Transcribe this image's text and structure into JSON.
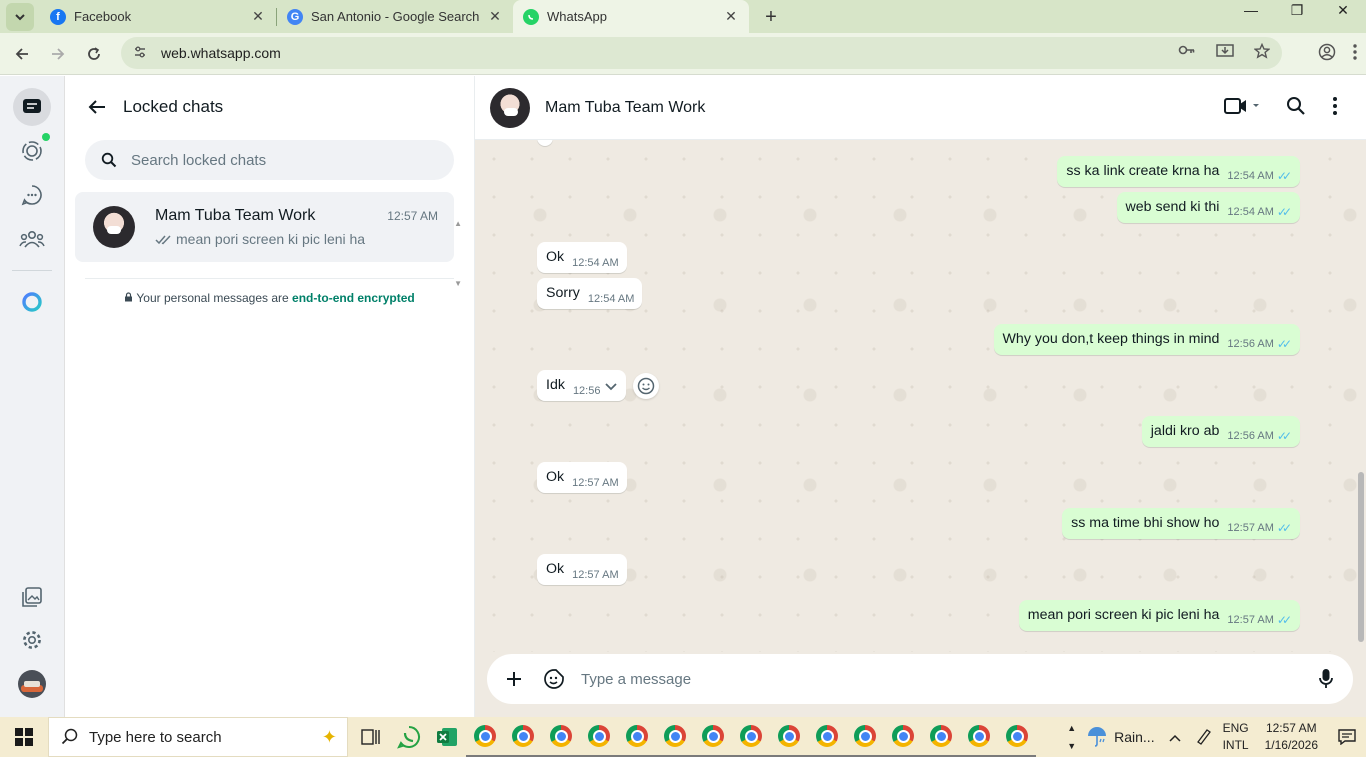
{
  "browser": {
    "tabs": [
      {
        "title": "Facebook",
        "icon": "facebook-icon",
        "color": "#1877f2"
      },
      {
        "title": "San Antonio - Google Search",
        "icon": "google-icon",
        "color": "#4285f4"
      },
      {
        "title": "WhatsApp",
        "icon": "whatsapp-icon",
        "color": "#25d366",
        "active": true
      }
    ],
    "url": "web.whatsapp.com",
    "tab_close": "✕",
    "new_tab": "+"
  },
  "sidebar": {
    "title": "Locked chats",
    "search_placeholder": "Search locked chats",
    "chat": {
      "name": "Mam Tuba Team Work",
      "time": "12:57 AM",
      "preview": "mean pori screen ki pic leni ha"
    },
    "encryption_prefix": "Your personal messages are ",
    "encryption_link": "end-to-end encrypted"
  },
  "conversation": {
    "contact_name": "Mam Tuba Team Work",
    "composer_placeholder": "Type a message",
    "messages": [
      {
        "dir": "out",
        "text": "ss ka link create krna ha",
        "time": "12:54 AM"
      },
      {
        "dir": "out",
        "text": "web send ki thi",
        "time": "12:54 AM"
      },
      {
        "dir": "in",
        "text": "Ok",
        "time": "12:54 AM"
      },
      {
        "dir": "in",
        "text": "Sorry",
        "time": "12:54 AM"
      },
      {
        "dir": "out",
        "text": "Why you don,t keep things in mind",
        "time": "12:56 AM"
      },
      {
        "dir": "in",
        "text": "Idk",
        "time": "12:56"
      },
      {
        "dir": "out",
        "text": "jaldi kro ab",
        "time": "12:56 AM"
      },
      {
        "dir": "in",
        "text": "Ok",
        "time": "12:57 AM"
      },
      {
        "dir": "out",
        "text": "ss ma time bhi show ho",
        "time": "12:57 AM"
      },
      {
        "dir": "in",
        "text": "Ok",
        "time": "12:57 AM"
      },
      {
        "dir": "out",
        "text": "mean pori screen ki pic leni ha",
        "time": "12:57 AM"
      }
    ]
  },
  "taskbar": {
    "search_placeholder": "Type here to search",
    "weather": "Rain...",
    "lang_top": "ENG",
    "lang_bottom": "INTL",
    "time": "12:57 AM",
    "date": "1/16/2026"
  },
  "colors": {
    "accent": "#008069",
    "outgoing_bubble": "#d9fdd3",
    "read_ticks": "#53bdeb"
  }
}
